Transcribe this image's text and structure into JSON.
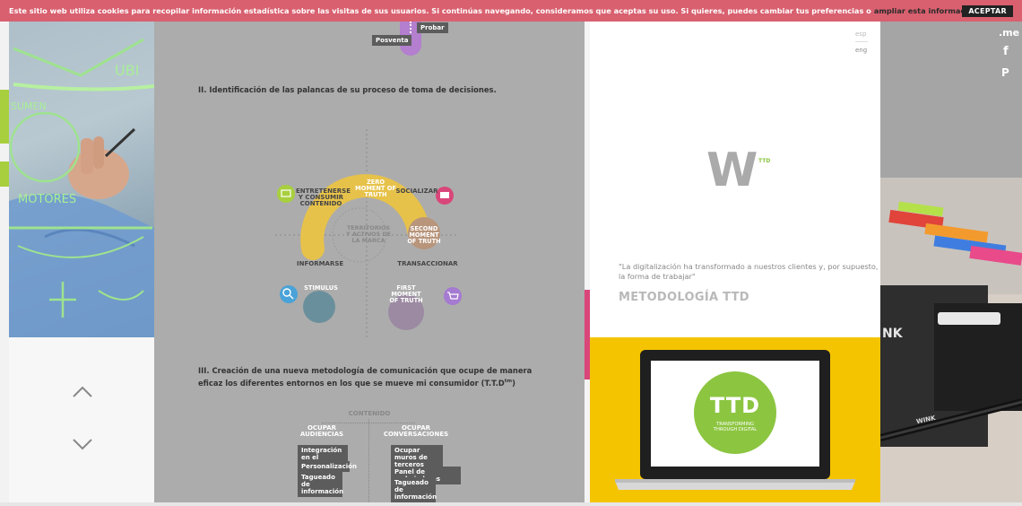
{
  "cookie": {
    "text": "Este sitio web utiliza cookies para recopilar información estadística sobre las visitas de sus usuarios. Si continúas navegando, consideramos que aceptas su uso. Si quieres, puedes cambiar tus preferencias o",
    "link": "ampliar esta información",
    "accept": "ACEPTAR"
  },
  "photo_left": {
    "words": [
      "UBI",
      "SUMEN",
      "MOTORES"
    ]
  },
  "content": {
    "top_labels": [
      "Probar",
      "Posventa"
    ],
    "section2_title": "II. Identificación de las palancas de su proceso de toma de decisiones.",
    "diagram": {
      "zero_moment": "ZERO MOMENT OF TRUTH",
      "second_moment": "SECOND MOMENT OF TRUTH",
      "first_moment": "FIRST MOMENT OF TRUTH",
      "stimulus": "STIMULUS",
      "entretenerse": "ENTRETENERSE Y CONSUMIR CONTENIDO",
      "socializar": "SOCIALIZAR",
      "informarse": "INFORMARSE",
      "transaccionar": "TRANSACCIONAR",
      "territorios": "TERRITORIOS Y ACTIVOS DE LA MARCA"
    },
    "section3_title": "III. Creación de una nueva metodología de comunicación que ocupe de manera eficaz los diferentes entornos en los que se mueve mi consumidor (T.T.D",
    "section3_sup": "tm",
    "section3_end": ")",
    "contenido": "CONTENIDO",
    "col1_heading": "OCUPAR AUDIENCIAS",
    "col2_heading": "OCUPAR CONVERSACIONES",
    "col1_items": [
      "Integración en el contenido",
      "Personalización",
      "Tagueado de información"
    ],
    "col2_items": [
      "Ocupar muros de terceros",
      "Panel de embajadores",
      "Tagueado de información"
    ]
  },
  "right": {
    "lang_esp": "esp",
    "lang_eng": "eng",
    "logo_letter": "W",
    "logo_sup": "TTD",
    "quote": "\"La digitalización ha transformado a nuestros clientes y, por supuesto, la forma de trabajar\"",
    "title": "METODOLOGÍA TTD",
    "ttd_big": "TTD",
    "ttd_sub": "TRANSFORMING THROUGH DIGITAL"
  },
  "social": {
    "me": ".me",
    "facebook": "f",
    "pinterest": "P"
  },
  "photo_right": {
    "box_text": "NK",
    "pencil_text": "WINK"
  },
  "colors": {
    "banner": "#d9606f",
    "accent_green": "#a8cf3e",
    "accent_pink": "#d9467a",
    "arc_yellow": "#e7c24a",
    "ttd_green": "#8cc540",
    "yellow": "#f5c400"
  }
}
